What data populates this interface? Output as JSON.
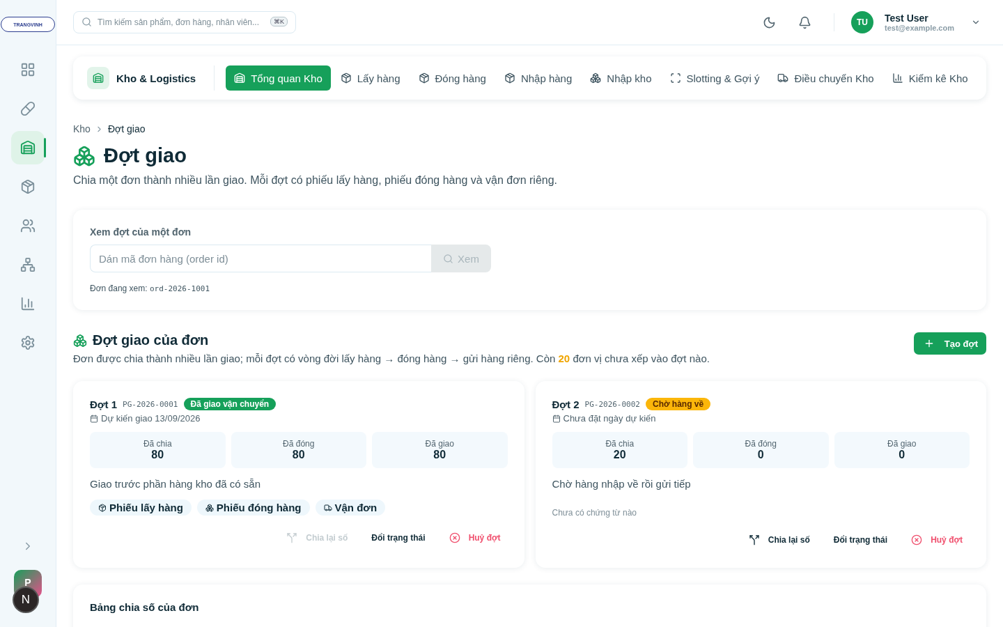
{
  "logo": {
    "text": "TRANGVINH"
  },
  "sidebar": {
    "items": [
      {
        "kind": "dashboard",
        "selected": false
      },
      {
        "kind": "pill",
        "selected": false
      },
      {
        "kind": "warehouse",
        "selected": true
      },
      {
        "kind": "package",
        "selected": false
      },
      {
        "kind": "users",
        "selected": false
      },
      {
        "kind": "network",
        "selected": false
      },
      {
        "kind": "chart",
        "selected": false
      },
      {
        "kind": "settings",
        "selected": false
      }
    ],
    "avatars": [
      "P",
      "N"
    ]
  },
  "search": {
    "placeholder": "Tìm kiếm sản phẩm, đơn hàng, nhân viên...",
    "shortcut": "⌘K"
  },
  "user": {
    "initials": "TU",
    "name": "Test User",
    "email": "test@example.com"
  },
  "module": {
    "title": "Kho & Logistics",
    "tabs": [
      {
        "label": "Tổng quan Kho",
        "kind": "warehouse",
        "selected": true
      },
      {
        "label": "Lấy hàng",
        "kind": "package",
        "selected": false
      },
      {
        "label": "Đóng hàng",
        "kind": "package",
        "selected": false
      },
      {
        "label": "Nhập hàng",
        "kind": "package",
        "selected": false
      },
      {
        "label": "Nhập kho",
        "kind": "boxes",
        "selected": false
      },
      {
        "label": "Slotting & Gợi ý",
        "kind": "scan",
        "selected": false
      },
      {
        "label": "Điều chuyển Kho",
        "kind": "truck",
        "selected": false
      },
      {
        "label": "Kiểm kê Kho",
        "kind": "chart",
        "selected": false
      }
    ]
  },
  "breadcrumb": [
    "Kho",
    "Đợt giao"
  ],
  "page": {
    "title": "Đợt giao",
    "subtitle": "Chia một đơn thành nhiều lần giao. Mỗi đợt có phiếu lấy hàng, phiếu đóng hàng và vận đơn riêng."
  },
  "lookup": {
    "label": "Xem đợt của một đơn",
    "placeholder": "Dán mã đơn hàng (order id)",
    "button": "Xem",
    "button_disabled": true,
    "current_label": "Đơn đang xem:",
    "current_code": "ord-2026-1001"
  },
  "section": {
    "title": "Đợt giao của đơn",
    "description_before": "Đơn được chia thành nhiều lần giao; mỗi đợt có vòng đời lấy hàng → đóng hàng → gửi hàng riêng. Còn",
    "highlight": "20",
    "description_after": "đơn vị chưa xếp vào đợt nào.",
    "button": "Tạo đợt"
  },
  "shipments": [
    {
      "title": "Đợt 1",
      "code": "PG-2026-0001",
      "status": "Đã giao vận chuyển",
      "kind": "shipped",
      "date": "Dự kiến giao 13/09/2026",
      "stats": [
        {
          "label": "Đã chia",
          "value": "80"
        },
        {
          "label": "Đã đóng",
          "value": "80"
        },
        {
          "label": "Đã giao",
          "value": "80"
        }
      ],
      "note": "Giao trước phần hàng kho đã có sẵn",
      "documents": [
        {
          "label": "Phiếu lấy hàng",
          "kind": "package"
        },
        {
          "label": "Phiếu đóng hàng",
          "kind": "boxes"
        },
        {
          "label": "Vận đơn",
          "kind": "truck"
        }
      ],
      "actions": [
        {
          "label": "Chia lại số",
          "kind": "split",
          "disabled": true
        },
        {
          "label": "Đổi trạng thái",
          "kind": "status",
          "disabled": false
        },
        {
          "label": "Huỷ đợt",
          "kind": "cancel",
          "disabled": false
        }
      ]
    },
    {
      "title": "Đợt 2",
      "code": "PG-2026-0002",
      "status": "Chờ hàng về",
      "kind": "waiting",
      "date": "Chưa đặt ngày dự kiến",
      "stats": [
        {
          "label": "Đã chia",
          "value": "20"
        },
        {
          "label": "Đã đóng",
          "value": "0"
        },
        {
          "label": "Đã giao",
          "value": "0"
        }
      ],
      "note": "Chờ hàng nhập về rồi gửi tiếp",
      "empty_documents": "Chưa có chứng từ nào",
      "actions": [
        {
          "label": "Chia lại số",
          "kind": "split",
          "disabled": false
        },
        {
          "label": "Đổi trạng thái",
          "kind": "status",
          "disabled": false
        },
        {
          "label": "Huỷ đợt",
          "kind": "cancel",
          "disabled": false
        }
      ]
    }
  ],
  "allocation": {
    "title": "Bảng chia số của đơn"
  }
}
